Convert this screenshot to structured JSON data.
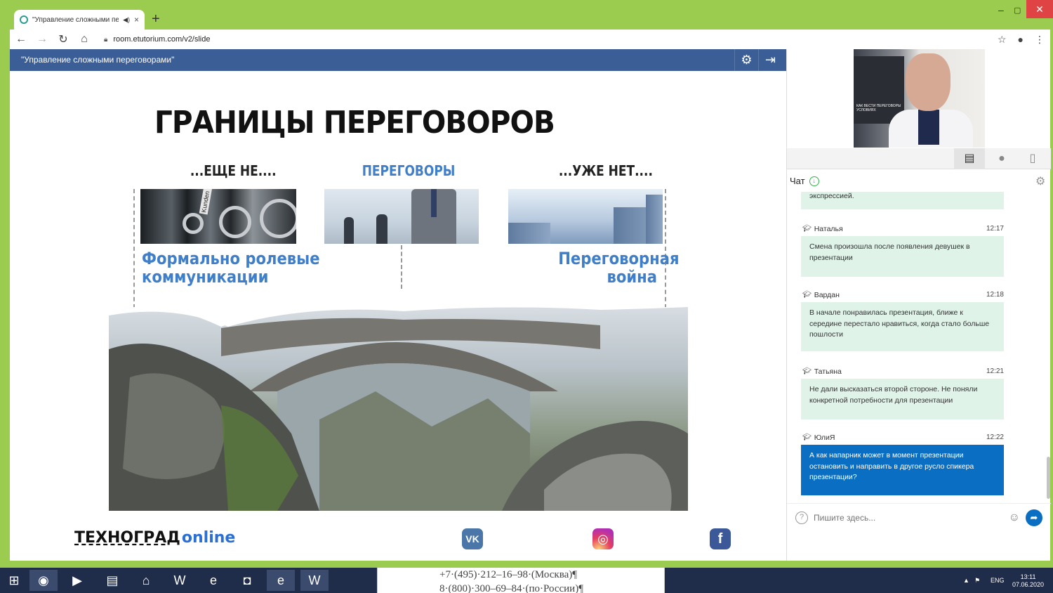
{
  "browser": {
    "tab_title": "\"Управление сложными пе",
    "url": "room.etutorium.com/v2/slide"
  },
  "app": {
    "title": "\"Управление сложными переговорами\""
  },
  "slide": {
    "title": "ГРАНИЦЫ ПЕРЕГОВОРОВ",
    "col_left": "...ЕЩЕ НЕ....",
    "col_mid": "ПЕРЕГОВОРЫ",
    "col_right": "...УЖЕ НЕТ....",
    "label_left_1": "Формально ролевые",
    "label_left_2": "коммуникации",
    "label_right_1": "Переговорная",
    "label_right_2": "война",
    "photo_files_label": "Kunden I-J",
    "video_poster_text": "КАК ВЕСТИ ПЕРЕГОВОРЫ УСЛОВИЯХ",
    "brand_name": "ТЕХНОГРАД",
    "brand_suffix": "online",
    "social_vk": "VK",
    "social_ig": "◎",
    "social_fb": "f"
  },
  "chat": {
    "header": "Чат",
    "first_fragment": "экспрессией.",
    "messages": [
      {
        "author": "Наталья",
        "time": "12:17",
        "text": "Смена произошла после появления девушек в презентации"
      },
      {
        "author": "Вардан",
        "time": "12:18",
        "text": "В начале понравилась презентация, ближе к середине перестало нравиться, когда стало больше пошлости"
      },
      {
        "author": "Татьяна",
        "time": "12:21",
        "text": "Не дали высказаться второй стороне. Не поняли конкретной потребности для презентации"
      },
      {
        "author": "ЮлиЯ",
        "time": "12:22",
        "text": "А как напарник может в момент презентации остановить и направить в другое русло спикера презентации?"
      }
    ],
    "input_placeholder": "Пишите здесь..."
  },
  "taskbar": {
    "doc_line_1": "+7·(495)·212–16–98·(Москва)¶",
    "doc_line_2": "8·(800)·300–69–84·(по·России)¶",
    "lang": "ENG",
    "time": "13:11",
    "date": "07.06.2020"
  },
  "colors": {
    "frame": "#9ccc4f",
    "header": "#3b5e96",
    "accent_blue": "#3f7fca",
    "bubble": "#dff3e9",
    "bubble_active": "#0a6fc2"
  }
}
